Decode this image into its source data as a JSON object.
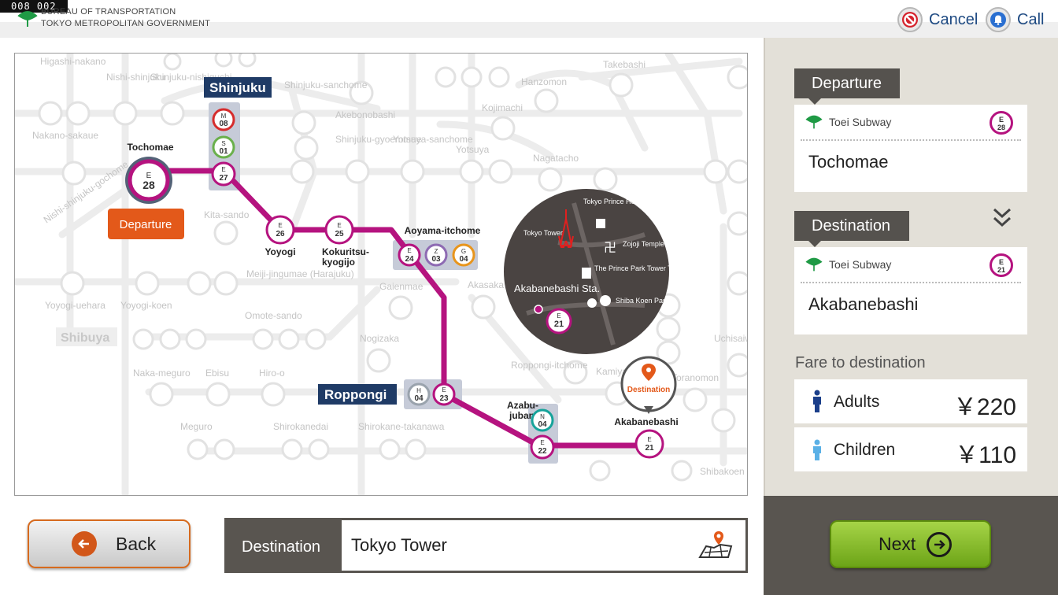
{
  "header": {
    "counter": "008  002",
    "org_line1": "BUREAU OF TRANSPORTATION",
    "org_line2": "TOKYO METROPOLITAN GOVERNMENT",
    "cancel_label": "Cancel",
    "call_label": "Call"
  },
  "map": {
    "route_color": "#b5137f",
    "area_labels": {
      "shinjuku": "Shinjuku",
      "roppongi": "Roppongi",
      "shibuya": "Shibuya"
    },
    "route_stations": [
      {
        "code_line": "E",
        "code_num": "28",
        "name": "Tochomae"
      },
      {
        "code_line": "E",
        "code_num": "27",
        "name": ""
      },
      {
        "code_line": "E",
        "code_num": "26",
        "name": "Yoyogi"
      },
      {
        "code_line": "E",
        "code_num": "25",
        "name": "Kokuritsu-kyogijo"
      },
      {
        "code_line": "E",
        "code_num": "24",
        "name": "Aoyama-itchome"
      },
      {
        "code_line": "E",
        "code_num": "23",
        "name": ""
      },
      {
        "code_line": "E",
        "code_num": "22",
        "name": "Azabu-juban"
      },
      {
        "code_line": "E",
        "code_num": "21",
        "name": "Akabanebashi"
      }
    ],
    "transfer_badges": [
      {
        "line": "M",
        "num": "08",
        "color": "#d62c2c"
      },
      {
        "line": "S",
        "num": "01",
        "color": "#6ab04c"
      },
      {
        "line": "Z",
        "num": "03",
        "color": "#8e6bb3"
      },
      {
        "line": "G",
        "num": "04",
        "color": "#e8951d"
      },
      {
        "line": "H",
        "num": "04",
        "color": "#9aa3ad"
      },
      {
        "line": "N",
        "num": "04",
        "color": "#16a39a"
      }
    ],
    "departure_label": "Departure",
    "destination_pin_label": "Destination",
    "inset": {
      "tokyo_tower": "Tokyo Tower",
      "prince_hotel": "Tokyo Prince Hotel",
      "zojoji": "Zojoji Temple",
      "park_tower": "The Prince Park Tower Tokyo",
      "station": "Akabanebashi Sta.",
      "shiba_park": "Shiba Koen Park",
      "badge_line": "E",
      "badge_num": "21"
    },
    "background_labels": {
      "higashi_nakano": "Higashi-nakano",
      "nishi_shinjuku": "Nishi-shinjuku",
      "shinjuku_nishiguchi": "Shinjuku-nishiguchi",
      "shinjuku_sanchome": "Shinjuku-sanchome",
      "akebonobashi": "Akebonobashi",
      "shinjuku_gyoemmae": "Shinjuku-gyoemmae",
      "yotsuya_sanchome": "Yotsuya-sanchome",
      "yotsuya": "Yotsuya",
      "kojimachi": "Kojimachi",
      "hanzomon": "Hanzomon",
      "takebashi": "Takebashi",
      "nagatacho": "Nagatacho",
      "nakano_sakaue": "Nakano-sakaue",
      "kita_sando": "Kita-sando",
      "meiji_jingumae": "Meiji-jingumae (Harajuku)",
      "yoyogi_uehara": "Yoyogi-uehara",
      "yoyogi_koen": "Yoyogi-koen",
      "gaienmae": "Gaienmae",
      "omote_sando": "Omote-sando",
      "nogizaka": "Nogizaka",
      "akasaka": "Akasaka",
      "naka_meguro": "Naka-meguro",
      "ebisu": "Ebisu",
      "hiro_o": "Hiro-o",
      "roppongi_itchome": "Roppongi-itchome",
      "meguro": "Meguro",
      "shirokanedai": "Shirokanedai",
      "shirokane_takanawa": "Shirokane-takanawa",
      "kamiyacho": "Kamiyacho",
      "toranomon": "Toranomon",
      "nishi_shinjuku_gochome": "Nishi-shinjuku-gochome",
      "shibakoen": "Shibakoen",
      "uchisaiwaicho": "Uchisaiwaicho",
      "shibuya_small": "Shibuya"
    }
  },
  "panel": {
    "departure_tag": "Departure",
    "departure_line": "Toei Subway",
    "departure_station": "Tochomae",
    "departure_code_line": "E",
    "departure_code_num": "28",
    "destination_tag": "Destination",
    "destination_line": "Toei Subway",
    "destination_station": "Akabanebashi",
    "destination_code_line": "E",
    "destination_code_num": "21",
    "fare_title": "Fare to destination",
    "adults_label": "Adults",
    "adults_fare": "￥220",
    "children_label": "Children",
    "children_fare": "￥110"
  },
  "footer": {
    "back_label": "Back",
    "destination_label": "Destination",
    "destination_value": "Tokyo Tower",
    "next_label": "Next"
  }
}
